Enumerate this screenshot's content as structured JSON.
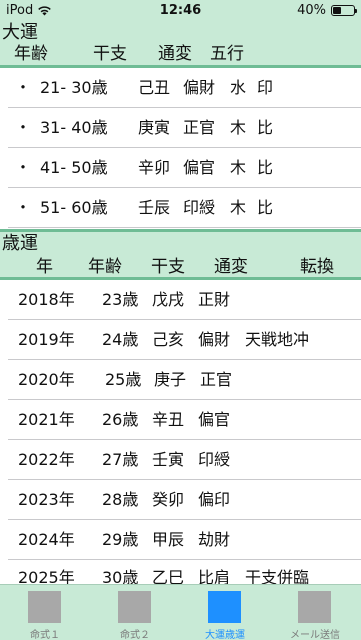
{
  "status": {
    "carrier": "iPod",
    "time": "12:46",
    "battery": "40%",
    "battery_level": 0.4
  },
  "daiun": {
    "title": "大運",
    "headers": [
      "年齢",
      "干支",
      "通変",
      "五行"
    ],
    "rows": [
      {
        "bullet": "・",
        "age": "21- 30歳",
        "kanshi": "己丑",
        "tsuhen": "偏財",
        "gogyo": "水",
        "rel": "印"
      },
      {
        "bullet": "・",
        "age": "31- 40歳",
        "kanshi": "庚寅",
        "tsuhen": "正官",
        "gogyo": "木",
        "rel": "比"
      },
      {
        "bullet": "・",
        "age": "41- 50歳",
        "kanshi": "辛卯",
        "tsuhen": "偏官",
        "gogyo": "木",
        "rel": "比"
      },
      {
        "bullet": "・",
        "age": "51- 60歳",
        "kanshi": "壬辰",
        "tsuhen": "印綬",
        "gogyo": "木",
        "rel": "比"
      }
    ]
  },
  "saiun": {
    "title": "歳運",
    "headers": [
      "年",
      "年齢",
      "干支",
      "通変",
      "転換"
    ],
    "rows": [
      {
        "year": "2018年",
        "age": "23歳",
        "kanshi": "戊戌",
        "tsuhen": "正財",
        "tenkan": ""
      },
      {
        "year": "2019年",
        "age": "24歳",
        "kanshi": "己亥",
        "tsuhen": "偏財",
        "tenkan": "天戦地冲"
      },
      {
        "year": "2020年",
        "age": "25歳",
        "kanshi": "庚子",
        "tsuhen": "正官",
        "tenkan": ""
      },
      {
        "year": "2021年",
        "age": "26歳",
        "kanshi": "辛丑",
        "tsuhen": "偏官",
        "tenkan": ""
      },
      {
        "year": "2022年",
        "age": "27歳",
        "kanshi": "壬寅",
        "tsuhen": "印綬",
        "tenkan": ""
      },
      {
        "year": "2023年",
        "age": "28歳",
        "kanshi": "癸卯",
        "tsuhen": "偏印",
        "tenkan": ""
      },
      {
        "year": "2024年",
        "age": "29歳",
        "kanshi": "甲辰",
        "tsuhen": "劫財",
        "tenkan": ""
      },
      {
        "year": "2025年",
        "age": "30歳",
        "kanshi": "乙巳",
        "tsuhen": "比肩",
        "tenkan": "干支併臨"
      }
    ]
  },
  "tabs": [
    {
      "label": "命式１",
      "active": false
    },
    {
      "label": "命式２",
      "active": false
    },
    {
      "label": "大運歳運",
      "active": true
    },
    {
      "label": "メール送信",
      "active": false
    }
  ]
}
